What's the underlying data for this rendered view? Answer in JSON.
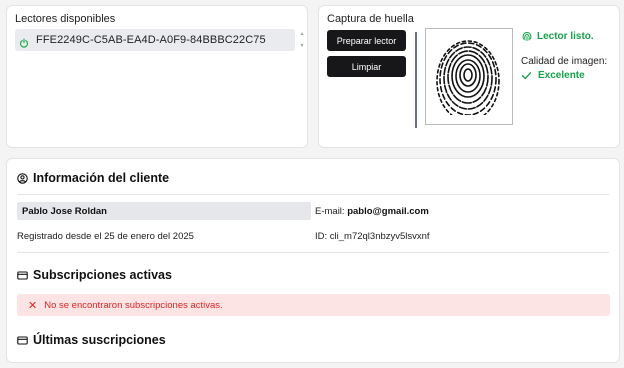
{
  "readers": {
    "title": "Lectores disponibles",
    "items": [
      {
        "id": "FFE2249C-C5AB-EA4D-A0F9-84BBBC22C75",
        "icon": "power-icon"
      }
    ]
  },
  "capture": {
    "title": "Captura de huella",
    "prepare_label": "Preparar lector",
    "clean_label": "Limpiar",
    "status_text": "Lector listo.",
    "quality_label": "Calidad de imagen:",
    "quality_value": "Excelente",
    "status_color": "#16a34a"
  },
  "client": {
    "title": "Información del cliente",
    "name": "Pablo Jose Roldan",
    "email_label": "E-mail:",
    "email_value": "pablo@gmail.com",
    "registered": "Registrado desde el 25 de enero del 2025",
    "id_text": "ID: cli_m72ql3nbzyv5lsvxnf"
  },
  "subscriptions": {
    "title": "Subscripciones activas",
    "empty_message": "No se encontraron subscripciones activas.",
    "alert_color": "#dc2626"
  },
  "last_subscriptions": {
    "title": "Últimas suscripciones"
  }
}
